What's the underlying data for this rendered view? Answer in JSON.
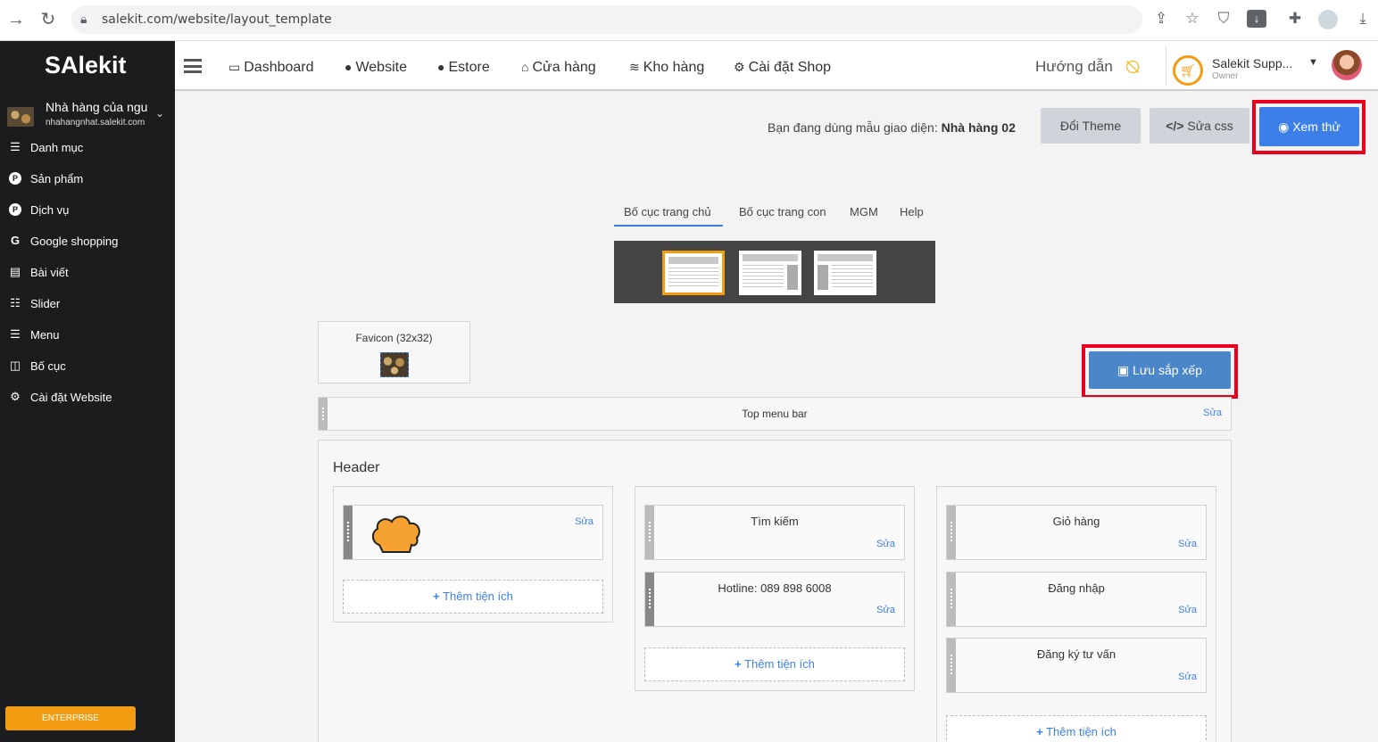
{
  "browser": {
    "url": "salekit.com/website/layout_template"
  },
  "sidebar": {
    "logo": "SAlekit",
    "shop_name": "Nhà hàng của ngu",
    "shop_url": "nhahangnhat.salekit.com",
    "items": [
      {
        "label": "Danh mục",
        "icon": "list-icon"
      },
      {
        "label": "Sản phẩm",
        "icon": "p-icon"
      },
      {
        "label": "Dịch vụ",
        "icon": "p-icon"
      },
      {
        "label": "Google shopping",
        "icon": "google-icon"
      },
      {
        "label": "Bài viết",
        "icon": "newspaper-icon"
      },
      {
        "label": "Slider",
        "icon": "sliders-icon"
      },
      {
        "label": "Menu",
        "icon": "list-icon"
      },
      {
        "label": "Bố cục",
        "icon": "columns-icon"
      },
      {
        "label": "Cài đặt Website",
        "icon": "gear-icon"
      }
    ],
    "badge": "ENTERPRISE"
  },
  "topnav": {
    "items": [
      {
        "label": "Dashboard",
        "icon": "monitor-icon"
      },
      {
        "label": "Website",
        "icon": "globe-icon"
      },
      {
        "label": "Estore",
        "icon": "globe-icon"
      },
      {
        "label": "Cửa hàng",
        "icon": "store-icon"
      },
      {
        "label": "Kho hàng",
        "icon": "layers-icon"
      },
      {
        "label": "Cài đặt Shop",
        "icon": "gear-icon"
      }
    ],
    "guide": "Hướng dẫn",
    "user_name": "Salekit Supp...",
    "user_role": "Owner"
  },
  "toolbar": {
    "theme_prefix": "Bạn đang dùng mẫu giao diện:",
    "theme_name": "Nhà hàng 02",
    "change_theme": "Đổi Theme",
    "edit_css": "Sửa css",
    "preview": "Xem thử"
  },
  "tabs": [
    "Bố cục trang chủ",
    "Bố cục trang con",
    "MGM",
    "Help"
  ],
  "favicon_label": "Favicon (32x32)",
  "save_order": "Lưu sắp xếp",
  "top_menu_bar": "Top menu bar",
  "edit": "Sửa",
  "header": {
    "title": "Header",
    "add_widget": "Thêm tiện ích",
    "col2": [
      "Tìm kiếm",
      "Hotline: 089 898 6008"
    ],
    "col3": [
      "Giỏ hàng",
      "Đăng nhập",
      "Đăng ký tư vấn"
    ]
  },
  "colors": {
    "sidebar_bg": "#1a1c1e",
    "accent_blue": "#3d7fe8",
    "highlight_red": "#e8001c",
    "badge_orange": "#f39c12"
  }
}
